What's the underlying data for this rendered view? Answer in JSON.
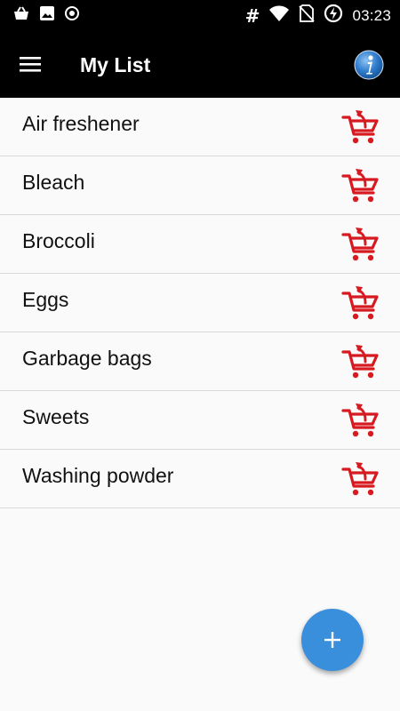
{
  "status_bar": {
    "time": "03:23",
    "left_icons": [
      "shopping-basket-icon",
      "image-icon",
      "record-icon"
    ],
    "right_icons": [
      "hash-icon",
      "wifi-icon",
      "no-sim-icon",
      "battery-charging-icon"
    ],
    "hash_glyph": "#"
  },
  "app_bar": {
    "title": "My List",
    "menu_icon": "hamburger-menu-icon",
    "info_icon": "info-icon"
  },
  "list": {
    "items": [
      {
        "label": "Air freshener"
      },
      {
        "label": "Bleach"
      },
      {
        "label": "Broccoli"
      },
      {
        "label": "Eggs"
      },
      {
        "label": "Garbage bags"
      },
      {
        "label": "Sweets"
      },
      {
        "label": "Washing powder"
      }
    ],
    "item_action_icon": "cart-return-icon"
  },
  "fab": {
    "icon": "plus-icon",
    "label": "+"
  },
  "colors": {
    "bar_background": "#000000",
    "page_background": "#fafafa",
    "cart_red": "#d71920",
    "fab_blue": "#3a8fdc",
    "divider": "#d9d9d9"
  }
}
